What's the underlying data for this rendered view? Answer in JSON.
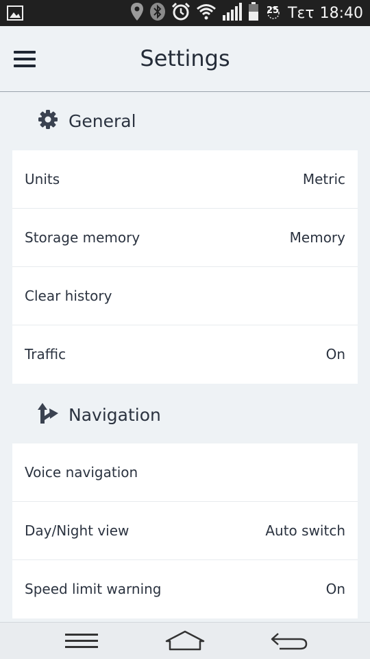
{
  "status_bar": {
    "day": "Τετ",
    "time": "18:40",
    "temperature": "25",
    "icons": [
      "gallery-icon",
      "location-icon",
      "bluetooth-icon",
      "alarm-icon",
      "wifi-icon",
      "signal-icon",
      "battery-icon",
      "weather-icon"
    ]
  },
  "app_bar": {
    "title": "Settings",
    "menu_icon": "hamburger-menu-icon"
  },
  "sections": {
    "general": {
      "title": "General",
      "icon": "gear-icon",
      "rows": [
        {
          "label": "Units",
          "value": "Metric"
        },
        {
          "label": "Storage memory",
          "value": "Memory"
        },
        {
          "label": "Clear history",
          "value": ""
        },
        {
          "label": "Traffic",
          "value": "On"
        }
      ]
    },
    "navigation": {
      "title": "Navigation",
      "icon": "route-arrow-icon",
      "rows": [
        {
          "label": "Voice navigation",
          "value": ""
        },
        {
          "label": "Day/Night view",
          "value": "Auto switch"
        },
        {
          "label": "Speed limit warning",
          "value": "On"
        }
      ]
    }
  },
  "system_nav": {
    "icons": [
      "recent-apps-icon",
      "home-icon",
      "back-icon"
    ]
  },
  "colors": {
    "background": "#eef2f5",
    "card": "#ffffff",
    "text": "#2b3340",
    "status_bar": "#202020"
  }
}
